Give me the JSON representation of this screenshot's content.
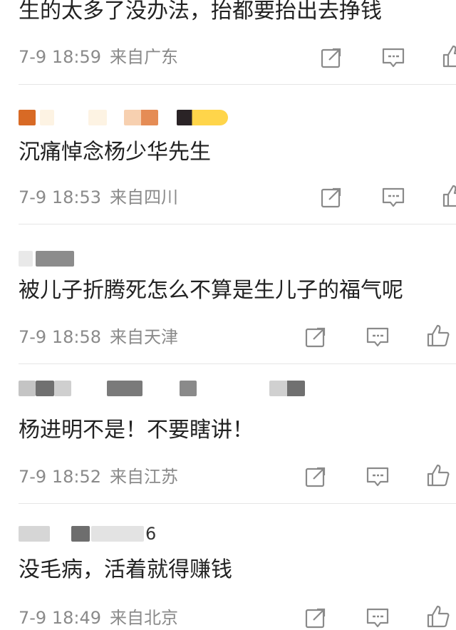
{
  "comments": [
    {
      "text": "生的太多了没办法，抬都要抬出去挣钱",
      "time": "7-9 18:59",
      "source": "来自广东"
    },
    {
      "text": "沉痛悼念杨少华先生",
      "time": "7-9 18:53",
      "source": "来自四川"
    },
    {
      "text": "被儿子折腾死怎么不算是生儿子的福气呢",
      "time": "7-9 18:58",
      "source": "来自天津"
    },
    {
      "text": "杨进明不是！不要瞎讲！",
      "time": "7-9 18:52",
      "source": "来自江苏"
    },
    {
      "text": "没毛病，活着就得赚钱",
      "time": "7-9 18:49",
      "source": "来自北京",
      "author_suffix": "6"
    }
  ],
  "icons": {
    "repost": "share-square-icon",
    "comment": "comment-bubble-icon",
    "like": "thumbs-up-icon"
  },
  "colors": {
    "text": "#222222",
    "meta": "#8a8a8a",
    "icon": "#8a8a8a",
    "divider": "#e6e6e6"
  }
}
